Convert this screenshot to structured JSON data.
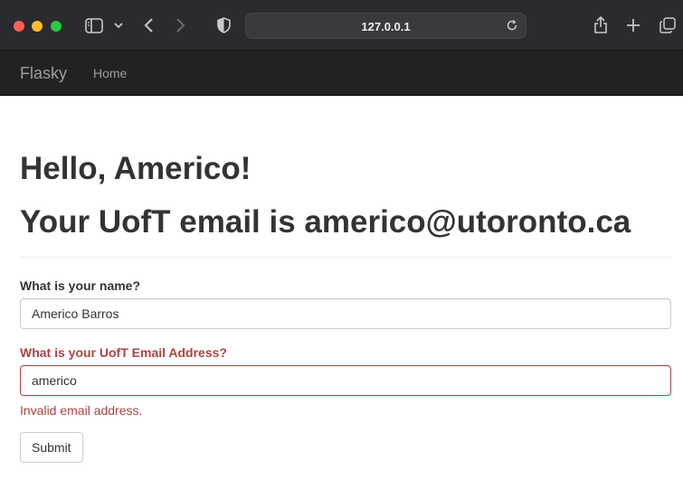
{
  "browser": {
    "url": "127.0.0.1",
    "icons": {
      "sidebar": "sidebar-icon",
      "chevron": "chevron-down-icon",
      "back": "back-arrow-icon",
      "forward": "forward-arrow-icon",
      "shield": "shield-icon",
      "reload": "reload-icon",
      "share": "share-icon",
      "new_tab": "plus-icon",
      "tabs": "tabs-overview-icon"
    }
  },
  "navbar": {
    "brand": "Flasky",
    "items": [
      {
        "label": "Home"
      }
    ]
  },
  "page": {
    "greeting": "Hello, Americo!",
    "email_line": "Your UofT email is americo@utoronto.ca"
  },
  "form": {
    "name_label": "What is your name?",
    "name_value": "Americo Barros",
    "email_label": "What is your UofT Email Address?",
    "email_value": "americo",
    "email_error": "Invalid email address.",
    "submit_label": "Submit"
  },
  "colors": {
    "navbar_bg": "#222222",
    "error": "#a94442",
    "chrome_bg": "#2b2a2e"
  }
}
